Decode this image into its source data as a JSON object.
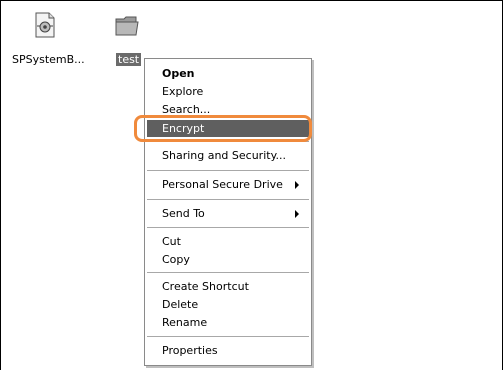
{
  "desktop": {
    "icons": [
      {
        "label": "SPSystemB...",
        "icon": "system-file-icon",
        "selected": false
      },
      {
        "label": "test",
        "icon": "folder-icon",
        "selected": true
      }
    ]
  },
  "context_menu": {
    "items": [
      {
        "label": "Open",
        "bold": true
      },
      {
        "label": "Explore"
      },
      {
        "label": "Search..."
      },
      {
        "label": "Encrypt",
        "highlighted": true
      },
      {
        "label": "Sharing and Security..."
      },
      {
        "label": "Personal Secure Drive",
        "submenu": true
      },
      {
        "label": "Send To",
        "submenu": true
      },
      {
        "label": "Cut"
      },
      {
        "label": "Copy"
      },
      {
        "label": "Create Shortcut"
      },
      {
        "label": "Delete"
      },
      {
        "label": "Rename"
      },
      {
        "label": "Properties"
      }
    ]
  },
  "colors": {
    "highlight": "#5f5f5f",
    "callout": "#f08a3c",
    "selection": "#6b6b6b"
  }
}
